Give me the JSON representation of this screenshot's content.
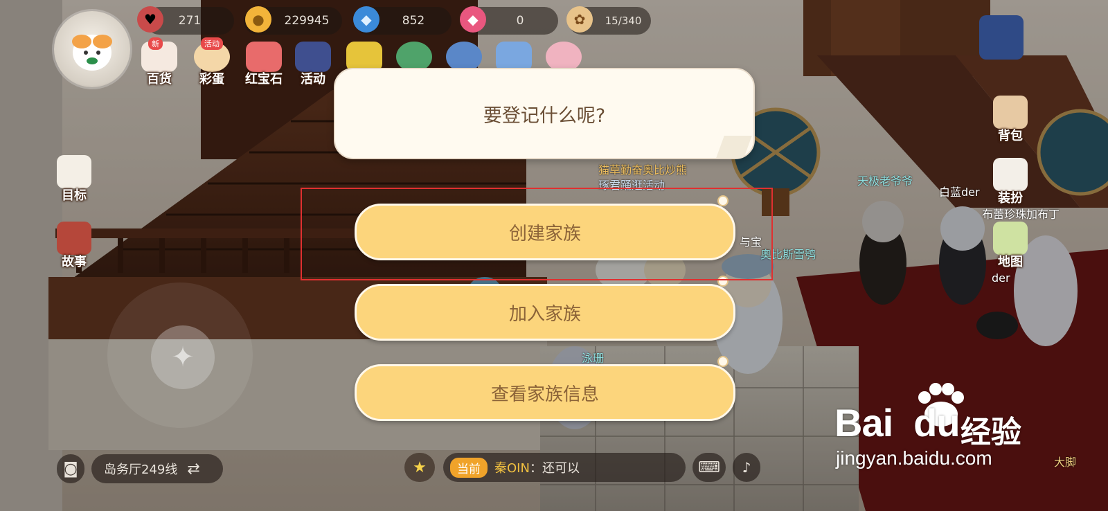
{
  "resources": [
    {
      "icon": "heart-icon",
      "value": "271"
    },
    {
      "icon": "coin-icon",
      "value": "229945"
    },
    {
      "icon": "diamond-icon",
      "value": "852"
    },
    {
      "icon": "gem-icon",
      "value": "0"
    },
    {
      "icon": "hamster-icon",
      "value": "15/340"
    }
  ],
  "top_menu": [
    {
      "label": "百货",
      "badge": "新"
    },
    {
      "label": "彩蛋",
      "badge": "活动"
    },
    {
      "label": "红宝石",
      "badge": ""
    },
    {
      "label": "活动",
      "badge": ""
    }
  ],
  "left_menu": [
    {
      "label": "目标"
    },
    {
      "label": "故事"
    }
  ],
  "right_menu": [
    {
      "label": "背包"
    },
    {
      "label": "装扮"
    },
    {
      "label": "地图"
    }
  ],
  "scene_names": {
    "n1": "天极老爷爷",
    "n2": "白蓝der",
    "n3": "布蕾珍珠加布丁",
    "n4": "奥比斯雪鸮",
    "n5": "der",
    "n6": "与宝",
    "n7": "泳珊",
    "n8": "大脚",
    "n9": "猫草勤奋奥比炒熊",
    "n10": "琢君踊逛活动"
  },
  "dialog": {
    "prompt": "要登记什么呢?",
    "options": [
      "创建家族",
      "加入家族",
      "查看家族信息"
    ]
  },
  "bottom": {
    "server_label": "岛务厅249线",
    "chat_channel": "当前",
    "chat_user": "秦OIN",
    "chat_text": "：还可以"
  },
  "watermark": {
    "logo": "Bai",
    "logo_du": "du",
    "cn": "经验",
    "url": "jingyan.baidu.com"
  },
  "colors": {
    "button_fill": "#fcd57c",
    "button_text": "#8b6338",
    "highlight": "#e03030",
    "bubble": "#fffaf0"
  }
}
